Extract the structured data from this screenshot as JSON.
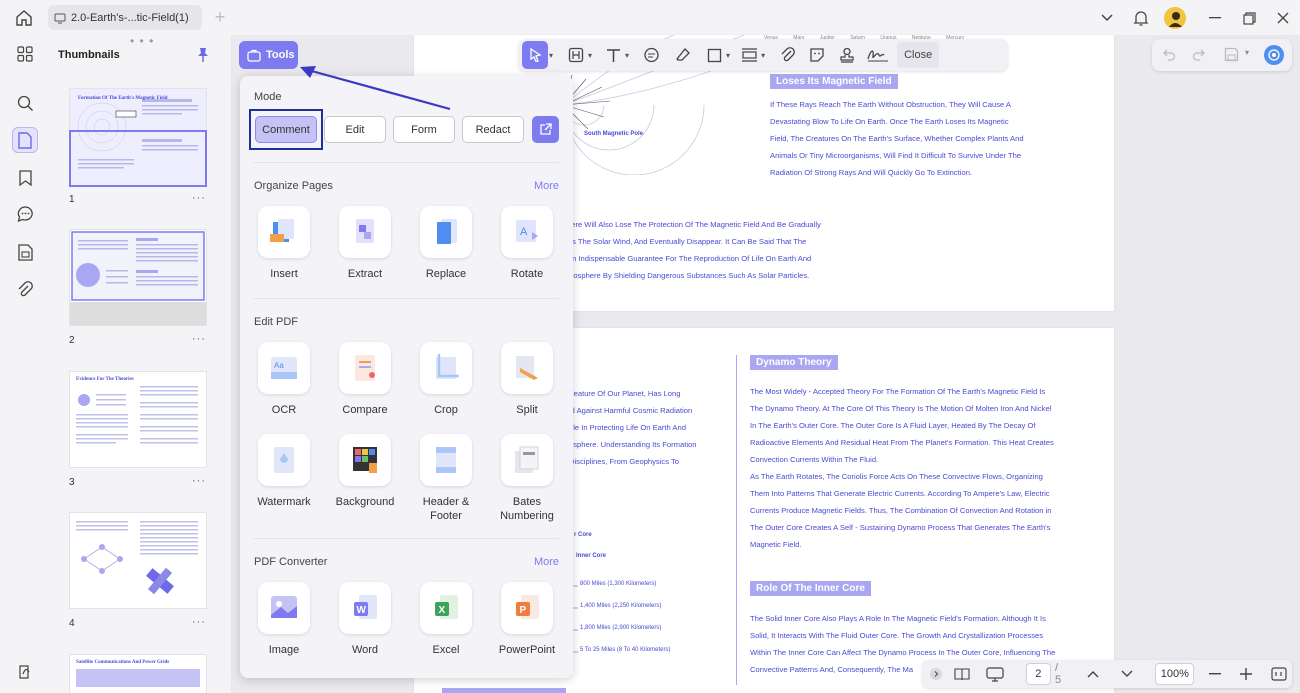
{
  "tab": {
    "title": "2.0-Earth's-...tic-Field(1)"
  },
  "thumbnails": {
    "title": "Thumbnails",
    "items": [
      {
        "number": "1",
        "heading": "Formation Of The Earth's Magnetic Field"
      },
      {
        "number": "2",
        "heading": ""
      },
      {
        "number": "3",
        "heading": "Evidence For The Theories"
      },
      {
        "number": "4",
        "heading": ""
      },
      {
        "number": "",
        "heading": "Satellite Communications And Power Grids"
      }
    ],
    "more_glyph": "···"
  },
  "toolbar": {
    "close_label": "Close",
    "tools_label": "Tools"
  },
  "tools_panel": {
    "mode_title": "Mode",
    "modes": [
      "Comment",
      "Edit",
      "Form",
      "Redact"
    ],
    "organize_title": "Organize Pages",
    "organize_more": "More",
    "organize_tools": [
      "Insert",
      "Extract",
      "Replace",
      "Rotate"
    ],
    "edit_title": "Edit PDF",
    "edit_tools": [
      "OCR",
      "Compare",
      "Crop",
      "Split",
      "Watermark",
      "Background",
      "Header & Footer",
      "Bates Numbering"
    ],
    "converter_title": "PDF Converter",
    "converter_more": "More",
    "converter_tools": [
      "Image",
      "Word",
      "Excel",
      "PowerPoint"
    ]
  },
  "document": {
    "page1": {
      "heading": "Loses Its Magnetic Field",
      "para1": [
        "If These Rays Reach The Earth Without Obstruction, They Will Cause A",
        "Devastating Blow To Life On Earth. Once The Earth Loses Its Magnetic",
        "Field, The Creatures On The Earth's Surface, Whether Complex Plants And",
        "Animals Or Tiny Microorganisms, Will Find It Difficult To Survive Under The",
        "Radiation Of Strong Rays And Will Quickly Go To Extinction."
      ],
      "para2": [
        "here Will Also Lose The Protection Of The Magnetic Field And Be Gradually",
        "As The Solar Wind, And Eventually Disappear. It Can Be Said That The",
        "An Indispensable Guarantee For The Reproduction Of Life On Earth And",
        "mosphere By Shielding Dangerous Substances Such As Solar Particles."
      ],
      "pole_label": "South Magnetic Pole",
      "planet_labels": [
        "Venus",
        "Mars",
        "Jupiter",
        "Saturn",
        "Uranus",
        "Neptune",
        "Mercury"
      ]
    },
    "page2": {
      "left_lines": [
        "Feature Of Our Planet, Has Long",
        "ld Against Harmful Cosmic Radiation",
        "ole In Protecting Life On Earth And",
        "osphere. Understanding Its Formation",
        "Disciplines, From Geophysics To"
      ],
      "diagram_labels": [
        "r Core",
        "Inner Core",
        "800 Miles (1,300 Kilometers)",
        "1,400 Miles (2,250 Kilometers)",
        "1,800 Miles (2,900 Kilometers)",
        "5 To 25 Miles (8 To 40 Kilometers)"
      ],
      "heading1": "Dynamo Theory",
      "para1": [
        "The Most Widely - Accepted Theory For The Formation Of The Earth's Magnetic Field Is",
        "The Dynamo Theory. At The Core Of This Theory Is The Motion Of Molten Iron And Nickel",
        "In The Earth's Outer Core. The Outer Core Is A Fluid Layer, Heated By The Decay Of",
        "Radioactive Elements And Residual Heat From The Planet's Formation. This Heat Creates",
        "Convection Currents Within The Fluid.",
        "As The Earth Rotates, The Coriolis Force Acts On These Convective Flows, Organizing",
        "Them Into Patterns That Generate Electric Currents. According To Ampere's Law, Electric",
        "Currents Produce Magnetic Fields. Thus, The Combination Of Convection And Rotation in",
        "The Outer Core Creates A Self - Sustaining Dynamo Process That Generates The Earth's",
        "Magnetic Field."
      ],
      "heading2": "Role Of The Inner Core",
      "para2": [
        "The Solid Inner Core Also Plays A Role In The Magnetic Field's Formation. Although It Is",
        "Solid, It Interacts With The Fluid Outer Core. The Growth And Crystallization Processes",
        "Within The Inner Core Can Affect The Dynamo Process In The Outer Core, Influencing The",
        "Convective Patterns And, Consequently, The Ma"
      ]
    }
  },
  "bottom_bar": {
    "current_page": "2",
    "total_pages": "/ 5",
    "zoom": "100%"
  }
}
